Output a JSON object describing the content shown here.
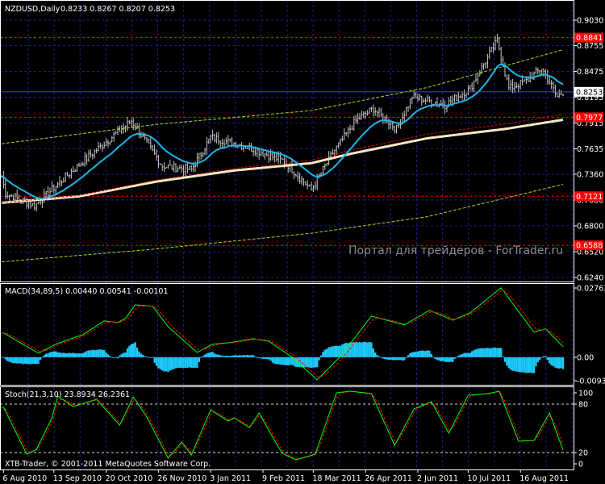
{
  "header": {
    "symbol_label": "NZDUSD,Daily",
    "ohlc": "0.8233 0.8267 0.8207 0.8253"
  },
  "watermark": "Портал для трейдеров - ForTrader.ru",
  "copyright": "XTB-Trader, © 2001-2011 MetaQuotes Software Corp.",
  "colors": {
    "background": "#000000",
    "grid": "#1c1c8c",
    "bars": "#c8c8c8",
    "ma_fast": "#1fb4e6",
    "ma_slow": "#f8e6c0",
    "envelope": "#a8d820",
    "level_line": "#ff0000",
    "macd_hist": "#1ec8f8",
    "signal": "#ff0000",
    "osc": "#00ff00"
  },
  "chart_data": [
    {
      "type": "line",
      "title": "NZDUSD,Daily",
      "bars_total": 291,
      "ylim": [
        0.624,
        0.903
      ],
      "yticks": [
        "0.9030",
        "0.8755",
        "0.8475",
        "0.8195",
        "0.7915",
        "0.7635",
        "0.7360",
        "0.7080",
        "0.6800",
        "0.6520",
        "0.6240"
      ],
      "current_price": "0.8253",
      "levels": [
        "0.8841",
        "0.7977",
        "0.7121",
        "0.6588"
      ],
      "close_keypoints": [
        [
          0,
          0.734
        ],
        [
          2,
          0.715
        ],
        [
          17,
          0.702
        ],
        [
          42,
          0.75
        ],
        [
          67,
          0.794
        ],
        [
          83,
          0.745
        ],
        [
          98,
          0.741
        ],
        [
          108,
          0.776
        ],
        [
          125,
          0.767
        ],
        [
          146,
          0.75
        ],
        [
          160,
          0.719
        ],
        [
          171,
          0.759
        ],
        [
          183,
          0.794
        ],
        [
          192,
          0.807
        ],
        [
          204,
          0.785
        ],
        [
          212,
          0.82
        ],
        [
          229,
          0.811
        ],
        [
          242,
          0.829
        ],
        [
          256,
          0.881
        ],
        [
          262,
          0.829
        ],
        [
          271,
          0.837
        ],
        [
          279,
          0.851
        ],
        [
          287,
          0.82
        ],
        [
          290,
          0.825
        ]
      ],
      "slow_ma": [
        [
          0,
          0.705
        ],
        [
          40,
          0.712
        ],
        [
          80,
          0.728
        ],
        [
          120,
          0.74
        ],
        [
          160,
          0.748
        ],
        [
          180,
          0.758
        ],
        [
          220,
          0.775
        ],
        [
          260,
          0.785
        ],
        [
          290,
          0.795
        ]
      ],
      "upper_envelope": [
        [
          0,
          0.769
        ],
        [
          80,
          0.79
        ],
        [
          160,
          0.805
        ],
        [
          220,
          0.83
        ],
        [
          290,
          0.871
        ]
      ],
      "lower_envelope": [
        [
          0,
          0.641
        ],
        [
          80,
          0.655
        ],
        [
          160,
          0.672
        ],
        [
          220,
          0.69
        ],
        [
          290,
          0.725
        ]
      ],
      "fast_ma_period": 20
    },
    {
      "type": "line",
      "title": "MACD(34,89,5) 0.00440 0.00541 -0.00101",
      "ylim": [
        -0.00939,
        0.02763
      ],
      "yticks": [
        "0.02763",
        "0.00",
        "-0.00939"
      ],
      "macd_keypoints": [
        [
          1,
          0.0097
        ],
        [
          19,
          0.0016
        ],
        [
          28,
          0.0052
        ],
        [
          42,
          0.009
        ],
        [
          53,
          0.0145
        ],
        [
          60,
          0.0138
        ],
        [
          64,
          0.0155
        ],
        [
          69,
          0.0209
        ],
        [
          78,
          0.0203
        ],
        [
          86,
          0.0122
        ],
        [
          101,
          0.0019
        ],
        [
          109,
          0.0052
        ],
        [
          118,
          0.0058
        ],
        [
          130,
          0.0074
        ],
        [
          138,
          0.0064
        ],
        [
          150,
          0.0
        ],
        [
          163,
          -0.009
        ],
        [
          175,
          0.0003
        ],
        [
          191,
          0.0164
        ],
        [
          208,
          0.0129
        ],
        [
          221,
          0.0187
        ],
        [
          233,
          0.0148
        ],
        [
          242,
          0.0177
        ],
        [
          258,
          0.0277
        ],
        [
          275,
          0.01
        ],
        [
          281,
          0.0113
        ],
        [
          290,
          0.0042
        ]
      ]
    },
    {
      "type": "line",
      "title": "Stoch(21,3,10) 23.8934 26.2361",
      "ylim": [
        0,
        100
      ],
      "yticks": [
        "100",
        "80",
        "20",
        "0"
      ],
      "levels": [
        80,
        20
      ],
      "stoch_keypoints": [
        [
          1,
          76
        ],
        [
          13,
          18
        ],
        [
          18,
          24
        ],
        [
          26,
          63
        ],
        [
          29,
          90
        ],
        [
          37,
          77
        ],
        [
          49,
          86
        ],
        [
          61,
          54
        ],
        [
          68,
          89
        ],
        [
          75,
          64
        ],
        [
          86,
          13
        ],
        [
          93,
          33
        ],
        [
          98,
          17
        ],
        [
          108,
          73
        ],
        [
          117,
          59
        ],
        [
          120,
          63
        ],
        [
          128,
          51
        ],
        [
          133,
          69
        ],
        [
          140,
          39
        ],
        [
          145,
          19
        ],
        [
          152,
          11
        ],
        [
          162,
          18
        ],
        [
          173,
          94
        ],
        [
          180,
          96
        ],
        [
          191,
          93
        ],
        [
          203,
          29
        ],
        [
          213,
          74
        ],
        [
          222,
          83
        ],
        [
          231,
          44
        ],
        [
          241,
          91
        ],
        [
          251,
          93
        ],
        [
          257,
          96
        ],
        [
          267,
          34
        ],
        [
          275,
          35
        ],
        [
          283,
          69
        ],
        [
          290,
          23
        ]
      ]
    }
  ],
  "x_axis": {
    "labels": [
      "6 Aug 2010",
      "13 Sep 2010",
      "20 Oct 2010",
      "26 Nov 2010",
      "3 Jan 2011",
      "9 Feb 2011",
      "18 Mar 2011",
      "26 Apr 2011",
      "2 Jun 2011",
      "10 Jul 2011",
      "16 Aug 2011"
    ],
    "label_bars": [
      1,
      27,
      54,
      81,
      108,
      135,
      161,
      188,
      215,
      241,
      268
    ]
  }
}
